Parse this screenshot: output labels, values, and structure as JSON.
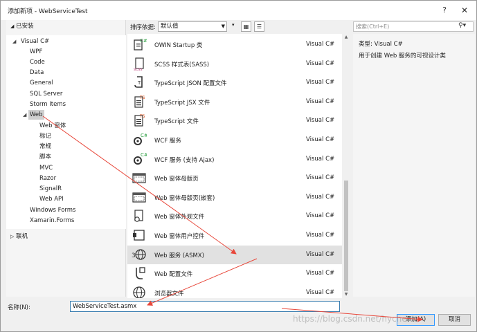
{
  "window": {
    "title": "添加新项 - WebServiceTest",
    "help": "?",
    "close": "✕"
  },
  "left": {
    "installed": "已安装",
    "tree": {
      "visual_csharp": "Visual C#",
      "wpf": "WPF",
      "code": "Code",
      "data": "Data",
      "general": "General",
      "sql_server": "SQL Server",
      "storm_items": "Storm Items",
      "web": "Web",
      "web_forms": "Web 窗体",
      "biaoji": "标记",
      "changgui": "常规",
      "jiaoben": "脚本",
      "mvc": "MVC",
      "razor": "Razor",
      "signalr": "SignalR",
      "web_api": "Web API",
      "windows_forms": "Windows Forms",
      "xamarin_forms": "Xamarin.Forms"
    },
    "online": "联机"
  },
  "sort": {
    "label": "排序依据:",
    "value": "默认值"
  },
  "templates": [
    {
      "name": "OWIN Startup 类",
      "type": "Visual C#",
      "icon": "owin-startup-icon"
    },
    {
      "name": "SCSS 样式表(SASS)",
      "type": "Visual C#",
      "icon": "scss-file-icon"
    },
    {
      "name": "TypeScript JSON 配置文件",
      "type": "Visual C#",
      "icon": "typescript-json-icon"
    },
    {
      "name": "TypeScript JSX 文件",
      "type": "Visual C#",
      "icon": "typescript-jsx-icon"
    },
    {
      "name": "TypeScript 文件",
      "type": "Visual C#",
      "icon": "typescript-file-icon"
    },
    {
      "name": "WCF 服务",
      "type": "Visual C#",
      "icon": "wcf-service-icon"
    },
    {
      "name": "WCF 服务 (支持 Ajax)",
      "type": "Visual C#",
      "icon": "wcf-ajax-icon"
    },
    {
      "name": "Web 窗体母版页",
      "type": "Visual C#",
      "icon": "master-page-icon"
    },
    {
      "name": "Web 窗体母版页(嵌套)",
      "type": "Visual C#",
      "icon": "nested-master-page-icon"
    },
    {
      "name": "Web 窗体外观文件",
      "type": "Visual C#",
      "icon": "skin-file-icon"
    },
    {
      "name": "Web 窗体用户控件",
      "type": "Visual C#",
      "icon": "user-control-icon"
    },
    {
      "name": "Web 服务 (ASMX)",
      "type": "Visual C#",
      "icon": "web-service-globe-icon"
    },
    {
      "name": "Web 配置文件",
      "type": "Visual C#",
      "icon": "web-config-icon"
    },
    {
      "name": "浏览器文件",
      "type": "Visual C#",
      "icon": "browser-file-globe-icon"
    }
  ],
  "search": {
    "placeholder": "搜索(Ctrl+E)"
  },
  "details": {
    "type": "类型:  Visual C#",
    "description": "用于创建 Web 服务的可视设计类"
  },
  "bottom": {
    "name_label": "名称(N):",
    "name_value": "WebServiceTest.asmx",
    "add_label": "添加(A)",
    "cancel_label": "取消"
  },
  "watermark": "https://blog.csdn.net/hychen",
  "colors": {
    "annotation_arrow": "#e8473a",
    "input_border": "#3c7fb1",
    "selected_row": "#e1e1e1"
  }
}
